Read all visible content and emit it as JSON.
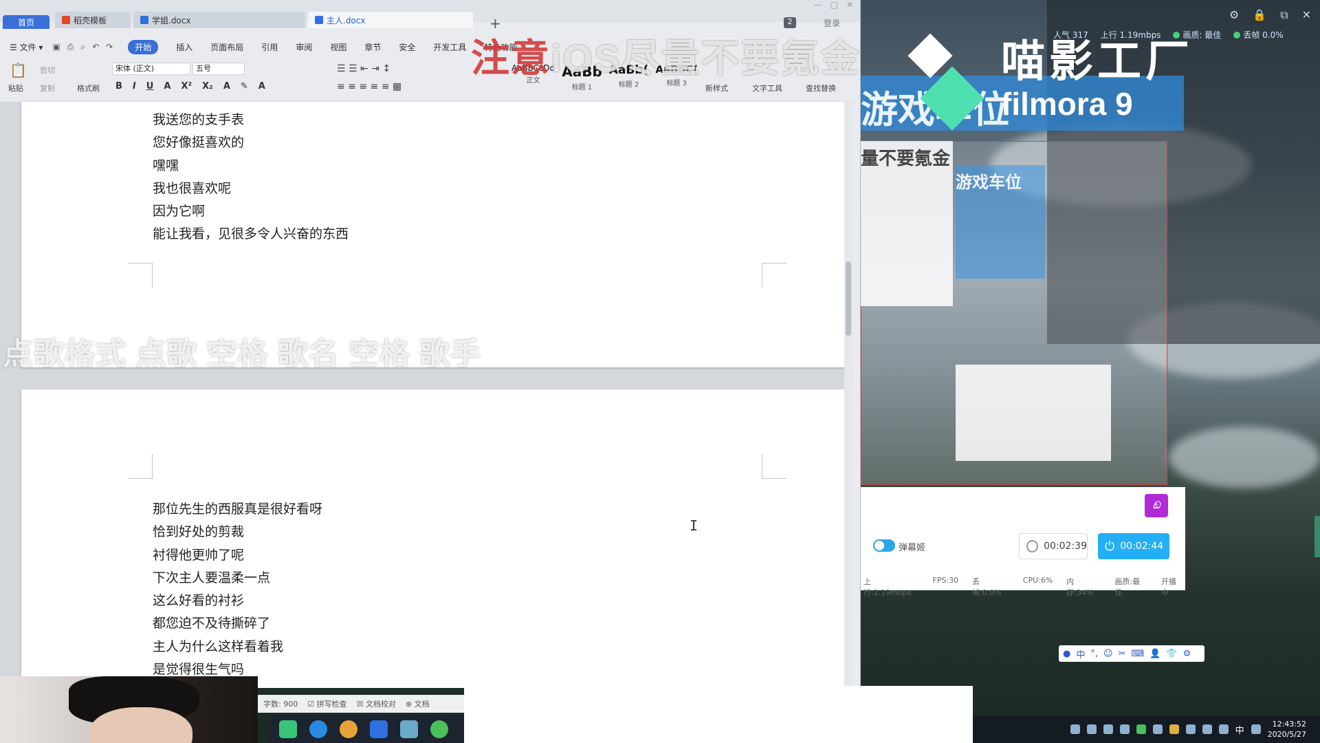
{
  "wps": {
    "tabs": [
      {
        "label": "首页"
      },
      {
        "label": "稻壳模板"
      },
      {
        "label": "学姐.docx"
      },
      {
        "label": "主人.docx"
      }
    ],
    "new_tab": "+",
    "window_badge": "2",
    "login": "登录",
    "menu": {
      "file": "文件",
      "items": [
        "开始",
        "插入",
        "页面布局",
        "引用",
        "审阅",
        "视图",
        "章节",
        "安全",
        "开发工具",
        "特色功能"
      ]
    },
    "ribbon": {
      "paste": "粘贴",
      "cut": "剪切",
      "copy": "复制",
      "format_painter": "格式刷",
      "font_name": "宋体 (正文)",
      "font_size": "五号",
      "bold": "B",
      "italic": "I",
      "underline": "U",
      "styles": [
        {
          "sample": "AaBbCcDd",
          "name": "正文"
        },
        {
          "sample": "AaBb",
          "name": "标题 1"
        },
        {
          "sample": "AaBb(",
          "name": "标题 2"
        },
        {
          "sample": "AaBbC(",
          "name": "标题 3"
        }
      ],
      "new_style": "新样式",
      "text_tools": "文字工具",
      "find_replace": "查找替换"
    },
    "page1_lines": [
      "我送您的支手表",
      "您好像挺喜欢的",
      "嘿嘿",
      "我也很喜欢呢",
      "因为它啊",
      "能让我看，见很多令人兴奋的东西"
    ],
    "page2_lines": [
      "那位先生的西服真是很好看呀",
      "恰到好处的剪裁",
      "衬得他更帅了呢",
      "下次主人要温柔一点",
      "这么好看的衬衫",
      "都您迫不及待撕碎了",
      "主人为什么这样看着我",
      "是觉得很生气吗"
    ],
    "status": {
      "word_count": "字数: 900",
      "spell_check": "拼写检查",
      "proofread": "文档校对",
      "doc": "文档"
    }
  },
  "overlays": {
    "warning_red": "注意",
    "warning_rest": "iOS尽量不要氪金",
    "song_format": "点歌格式 点歌 空格 歌名 空格 歌手",
    "parking": "游戏车位",
    "nested_warning": "量不要氪金",
    "nested_parking": "游戏车位"
  },
  "filmora": {
    "cn": "喵影工厂",
    "en": "filmora 9"
  },
  "stream_stats": {
    "popularity": "人气 317",
    "upload": "上行 1.19mbps",
    "quality": "画质: 最佳",
    "drop": "丢帧 0.0%"
  },
  "recorder": {
    "danmaku_label": "弹幕姬",
    "timer_left": "00:02:39",
    "timer_right": "00:02:44",
    "logo": "ඞ",
    "stats": [
      "上行:1.19mbps",
      "FPS:30",
      "丢帧:0.0%",
      "CPU:6%",
      "内存:34%",
      "画质:最佳",
      "开播中"
    ]
  },
  "ime_bar": {
    "lang": "中",
    "punct": "°,"
  },
  "tray": {
    "ime": "中",
    "time": "12:43:52",
    "date": "2020/5/27"
  },
  "colors": {
    "accent_blue": "#3a6fd8",
    "stream_blue": "#23aef5",
    "filmora_green": "#4fe0b0",
    "warning_red": "#d23a3a"
  }
}
